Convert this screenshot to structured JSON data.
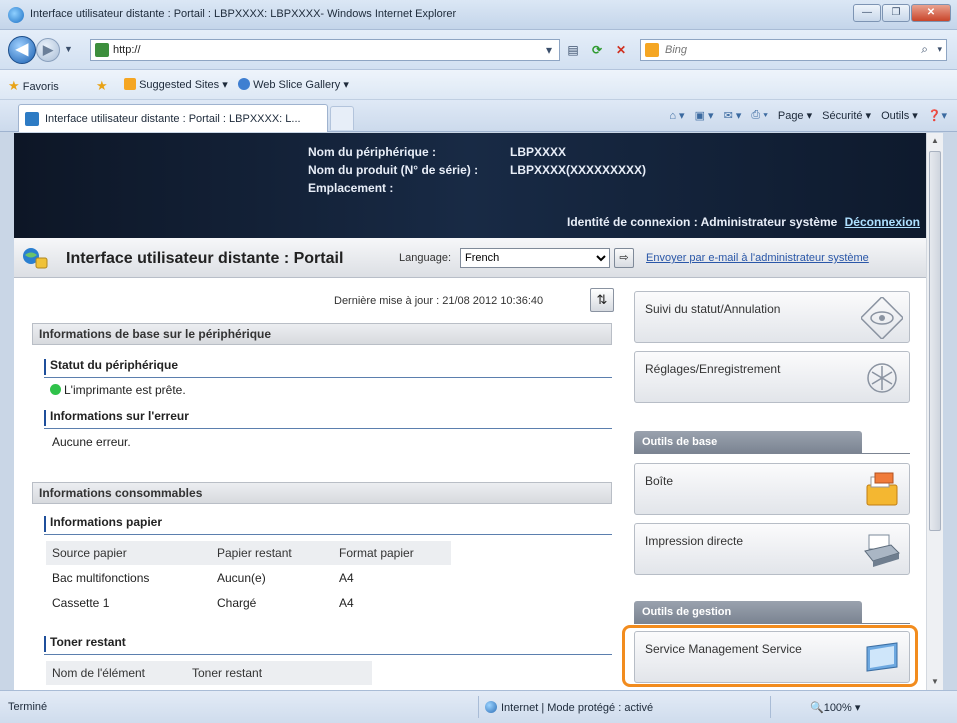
{
  "window": {
    "title": "Interface utilisateur distante : Portail : LBPXXXX: LBPXXXX- Windows Internet Explorer",
    "minimize": "—",
    "maximize": "❐",
    "close": "✕"
  },
  "address": {
    "url": "http://",
    "search_placeholder": "Bing"
  },
  "favorites": {
    "favorites_label": "Favoris",
    "suggested": "Suggested Sites ▾",
    "slice": "Web Slice Gallery ▾"
  },
  "tab": {
    "label": "Interface utilisateur distante : Portail : LBPXXXX: L..."
  },
  "command_bar": {
    "page": "Page ▾",
    "security": "Sécurité ▾",
    "tools": "Outils ▾",
    "help": "❓▾"
  },
  "device_header": {
    "device_name_label": "Nom du périphérique :",
    "device_name_value": "LBPXXXX",
    "product_label": "Nom du produit (N° de série) :",
    "product_value": "LBPXXXX(XXXXXXXXX)",
    "location_label": "Emplacement :",
    "login_text": "Identité de connexion : Administrateur système",
    "logout": "Déconnexion"
  },
  "portal": {
    "title": "Interface utilisateur distante : Portail",
    "language_label": "Language:",
    "language_value": "French",
    "mail_link": "Envoyer par e-mail à l'administrateur système"
  },
  "main": {
    "last_update": "Dernière mise à jour : 21/08 2012 10:36:40",
    "basic_info_title": "Informations de base sur le périphérique",
    "device_status_title": "Statut du périphérique",
    "device_status_text": "L'imprimante est prête.",
    "error_info_title": "Informations sur l'erreur",
    "error_text": "Aucune erreur.",
    "consumables_title": "Informations consommables",
    "paper_info_title": "Informations papier",
    "paper_table": {
      "headers": [
        "Source papier",
        "Papier restant",
        "Format papier"
      ],
      "rows": [
        [
          "Bac multifonctions",
          "Aucun(e)",
          "A4"
        ],
        [
          "Cassette 1",
          "Chargé",
          "A4"
        ]
      ]
    },
    "toner_title": "Toner restant",
    "toner_table": {
      "headers": [
        "Nom de l'élément",
        "Toner restant"
      ]
    }
  },
  "menu": {
    "status_monitor": "Suivi du statut/Annulation",
    "settings": "Réglages/Enregistrement",
    "basic_tools": "Outils de base",
    "box": "Boîte",
    "direct_print": "Impression directe",
    "management_tools": "Outils de gestion",
    "sms": "Service Management Service"
  },
  "statusbar": {
    "left": "Terminé",
    "zone": "Internet | Mode protégé : activé",
    "zoom": "🔍100%  ▾"
  },
  "colors": {
    "highlight": "#f28c1e",
    "header_bg": "#0d1626",
    "status_ready": "#2fc24a"
  }
}
